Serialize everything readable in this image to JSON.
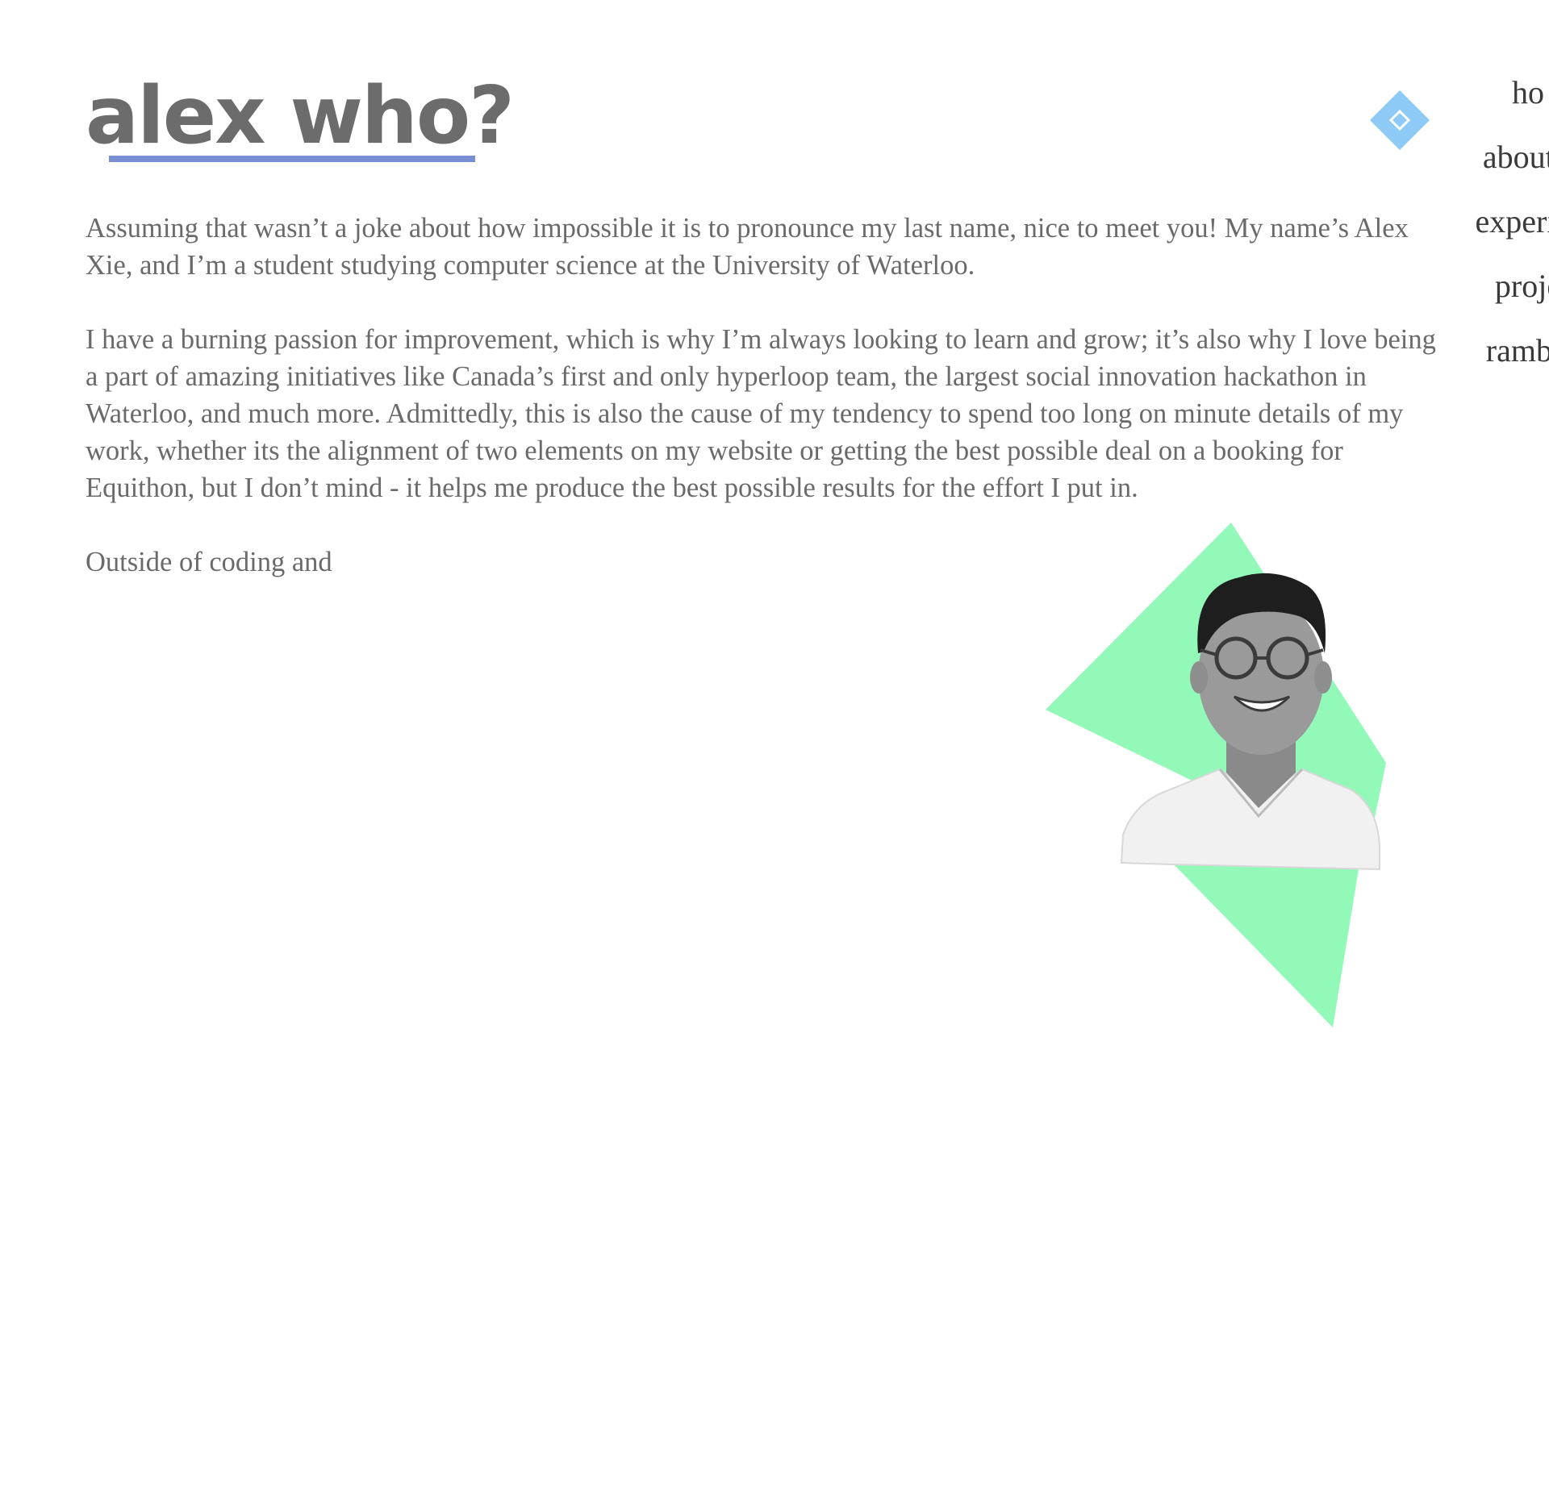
{
  "header": {
    "title": "alex who?"
  },
  "nav": {
    "items": [
      {
        "label": "ho"
      },
      {
        "label": "about r"
      },
      {
        "label": "experier"
      },
      {
        "label": "proje"
      },
      {
        "label": "rambli"
      }
    ]
  },
  "main": {
    "paragraphs": [
      "Assuming that wasn’t a joke about how impossible it is to pronounce my last name, nice to meet you! My name’s Alex Xie, and I’m a student studying computer science at the University of Waterloo.",
      "I have a burning passion for improvement, which is why I’m always looking to learn and grow; it’s also why I love being a part of amazing initiatives like Canada’s first and only hyperloop team, the largest social innovation hackathon in Waterloo, and much more. Admittedly, this is also the cause of my tendency to spend too long on minute details of my work, whether its the alignment of two elements on my website or getting the best possible deal on a booking for Equithon, but I don’t mind - it helps me produce the best possible results for the effort I put in.",
      "Outside of coding and"
    ]
  },
  "colors": {
    "accent_blue": "#7a8fd3",
    "logo_blue": "#8ecaf6",
    "shape_green": "#93f9b9",
    "text_gray": "#6a6a6a"
  },
  "icons": {
    "logo": "diamond-logo-icon"
  }
}
